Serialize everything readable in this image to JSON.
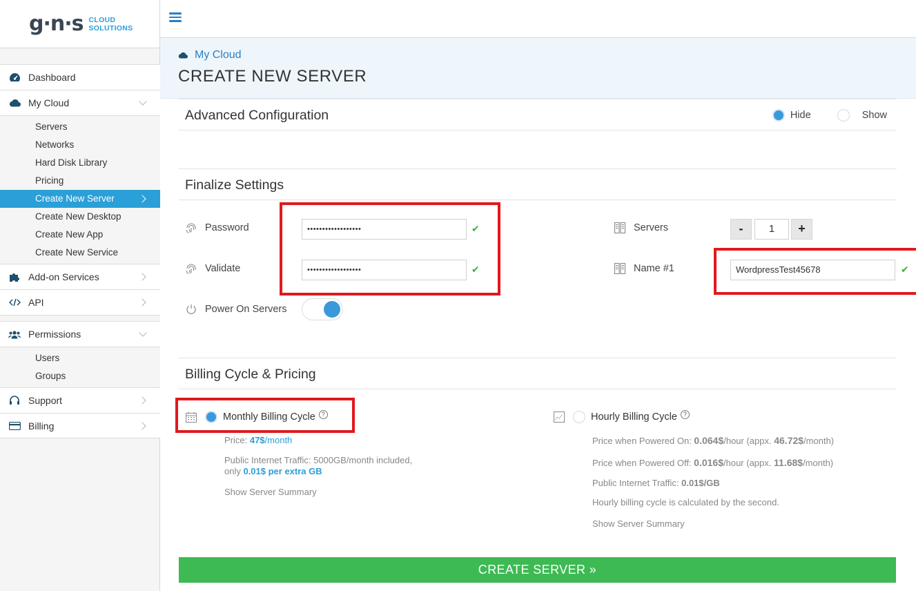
{
  "brand": {
    "logo_mark": "g·n·s",
    "logo_line1": "CLOUD",
    "logo_line2": "SOLUTIONS"
  },
  "sidebar": {
    "items": [
      {
        "label": "Dashboard",
        "icon": "dashboard-icon"
      },
      {
        "label": "My Cloud",
        "icon": "cloud-icon"
      },
      {
        "label": "Add-on Services",
        "icon": "puzzle-icon"
      },
      {
        "label": "API",
        "icon": "code-icon"
      },
      {
        "label": "Permissions",
        "icon": "users-icon"
      },
      {
        "label": "Support",
        "icon": "headset-icon"
      },
      {
        "label": "Billing",
        "icon": "credit-card-icon"
      }
    ],
    "mycloud_sub": [
      "Servers",
      "Networks",
      "Hard Disk Library",
      "Pricing",
      "Create New Server",
      "Create New Desktop",
      "Create New App",
      "Create New Service"
    ],
    "permissions_sub": [
      "Users",
      "Groups"
    ],
    "active_sub": "Create New Server"
  },
  "header": {
    "breadcrumb": "My Cloud",
    "title": "CREATE NEW SERVER"
  },
  "advanced": {
    "title": "Advanced Configuration",
    "hide_label": "Hide",
    "show_label": "Show",
    "selected": "Hide"
  },
  "finalize": {
    "title": "Finalize Settings",
    "password_label": "Password",
    "password_value": "••••••••••••••••••",
    "validate_label": "Validate",
    "validate_value": "••••••••••••••••••",
    "power_label": "Power On Servers",
    "power_on": true,
    "servers_label": "Servers",
    "servers_count": "1",
    "minus_label": "-",
    "plus_label": "+",
    "name_label": "Name #1",
    "name_value": "WordpressTest45678",
    "check_glyph": "✔"
  },
  "billing": {
    "title": "Billing Cycle & Pricing",
    "monthly": {
      "label": "Monthly Billing Cycle",
      "help": "?",
      "price_prefix": "Price: ",
      "price_value": "47$",
      "price_unit": "/month",
      "traffic_line1": "Public Internet Traffic: 5000GB/month included,",
      "traffic_line2_prefix": "only ",
      "traffic_line2_value": "0.01$ per extra GB",
      "summary": "Show Server Summary"
    },
    "hourly": {
      "label": "Hourly Billing Cycle",
      "help": "?",
      "on_prefix": "Price when Powered On: ",
      "on_value": "0.064$",
      "on_mid": "/hour (appx. ",
      "on_month": "46.72$",
      "on_suffix": "/month)",
      "off_prefix": "Price when Powered Off: ",
      "off_value": "0.016$",
      "off_mid": "/hour (appx. ",
      "off_month": "11.68$",
      "off_suffix": "/month)",
      "traffic_prefix": "Public Internet Traffic: ",
      "traffic_value": "0.01$/GB",
      "note": "Hourly billing cycle is calculated by the second.",
      "summary": "Show Server Summary"
    },
    "selected": "monthly"
  },
  "action": {
    "create_label": "CREATE SERVER »"
  },
  "colors": {
    "accent": "#2a9fd8",
    "success": "#3dba53",
    "highlight": "#e0191e"
  }
}
